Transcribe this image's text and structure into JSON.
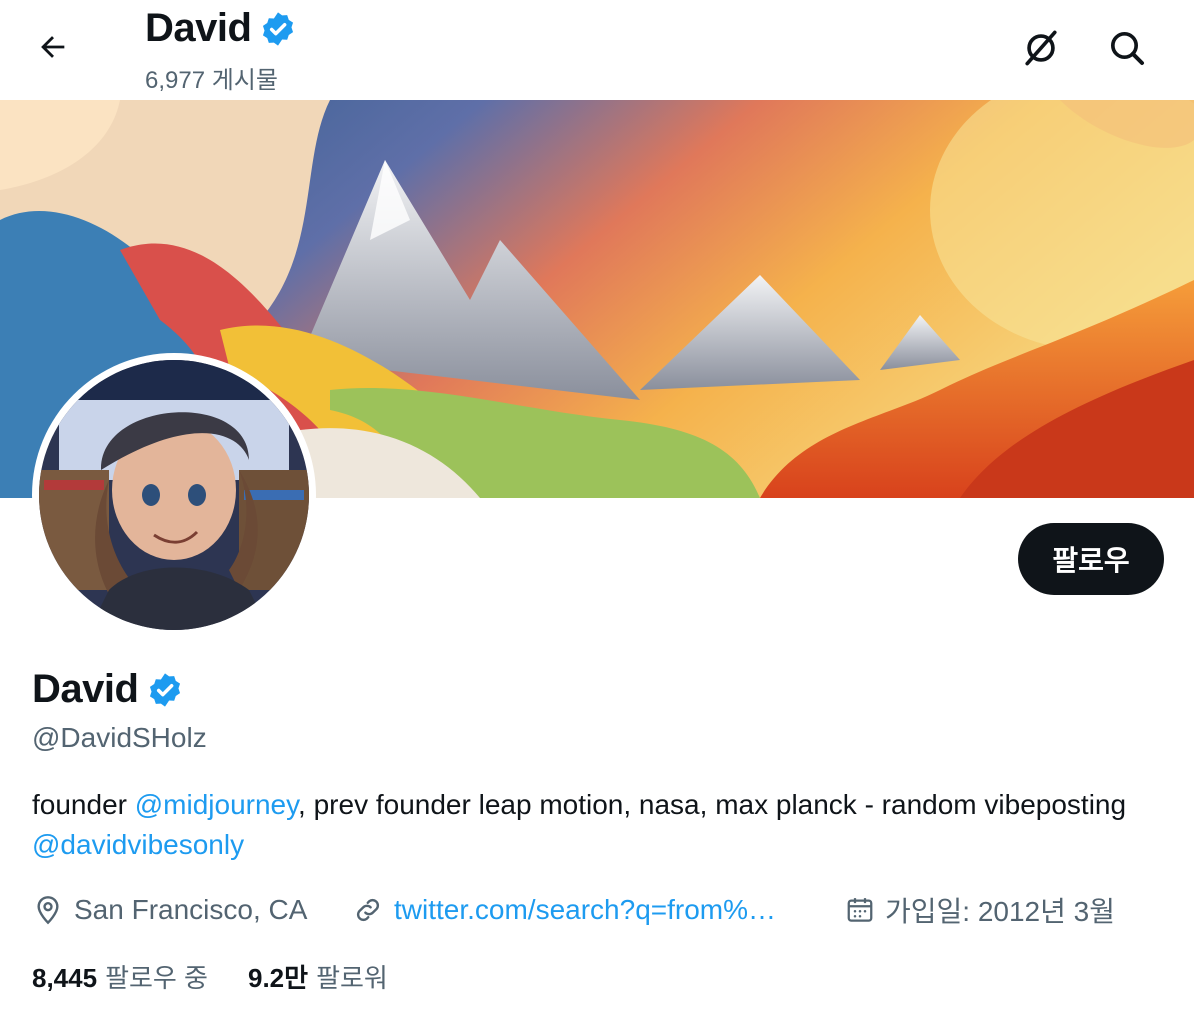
{
  "header": {
    "title": "David",
    "post_count": "6,977 게시물",
    "back_icon": "arrow-left-icon",
    "verified_icon": "verified-badge-icon",
    "actions": [
      "no-disturb-icon",
      "search-icon"
    ]
  },
  "profile": {
    "follow_label": "팔로우",
    "display_name": "David",
    "handle": "@DavidSHolz",
    "bio": {
      "p1": "founder ",
      "m1": "@midjourney",
      "p2": ", prev founder leap motion, nasa, max planck - random vibeposting ",
      "m2": "@davidvibesonly"
    },
    "location": "San Francisco, CA",
    "website": "twitter.com/search?q=from%…",
    "joined": "가입일: 2012년 3월",
    "following_count": "8,445",
    "following_label": "팔로우 중",
    "followers_count": "9.2만",
    "followers_label": "팔로워"
  },
  "colors": {
    "accent": "#1d9bf0",
    "text": "#0f1419",
    "muted": "#536471",
    "button_bg": "#0f1419"
  }
}
